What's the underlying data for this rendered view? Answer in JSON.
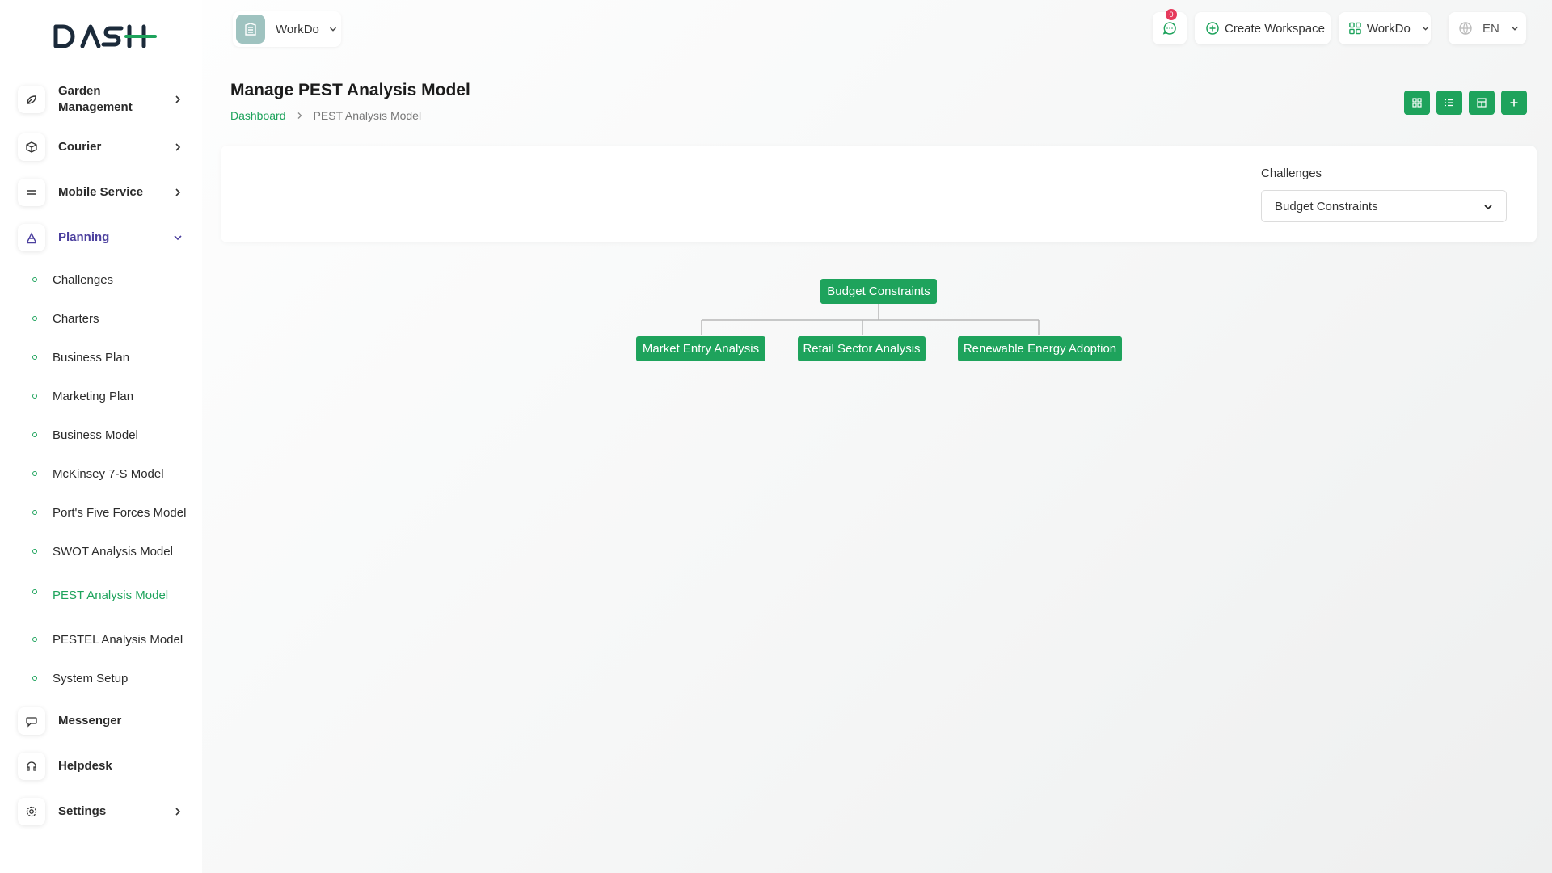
{
  "brand": {
    "logo_text": "DASH",
    "accent": "#1ea35c"
  },
  "sidebar": {
    "main_items": [
      {
        "label": "Garden Management",
        "icon": "plant-icon",
        "has_children": true
      },
      {
        "label": "Courier",
        "icon": "box-icon",
        "has_children": true
      },
      {
        "label": "Mobile Service",
        "icon": "menu-lines-icon",
        "has_children": true
      },
      {
        "label": "Planning",
        "icon": "letter-a-icon",
        "has_children": true,
        "expanded": true
      }
    ],
    "planning_items": [
      "Challenges",
      "Charters",
      "Business Plan",
      "Marketing Plan",
      "Business Model",
      "McKinsey 7-S Model",
      "Port's Five Forces Model",
      "SWOT Analysis Model",
      "PEST Analysis Model",
      "PESTEL Analysis Model",
      "System Setup"
    ],
    "active_item": "PEST Analysis Model",
    "bottom_items": [
      {
        "label": "Messenger",
        "icon": "chat-icon"
      },
      {
        "label": "Helpdesk",
        "icon": "headset-icon"
      },
      {
        "label": "Settings",
        "icon": "gear-icon",
        "has_children": true
      }
    ]
  },
  "topbar": {
    "workspace_name": "WorkDo",
    "notification_count": "0",
    "create_workspace_label": "Create Workspace",
    "user_workspace_label": "WorkDo",
    "language": "EN"
  },
  "header": {
    "title": "Manage PEST Analysis Model",
    "breadcrumb": {
      "home": "Dashboard",
      "current": "PEST Analysis Model"
    }
  },
  "filter": {
    "label": "Challenges",
    "selected": "Budget Constraints"
  },
  "tree": {
    "root": "Budget Constraints",
    "children": [
      "Market Entry Analysis",
      "Retail Sector Analysis",
      "Renewable Energy Adoption"
    ]
  }
}
